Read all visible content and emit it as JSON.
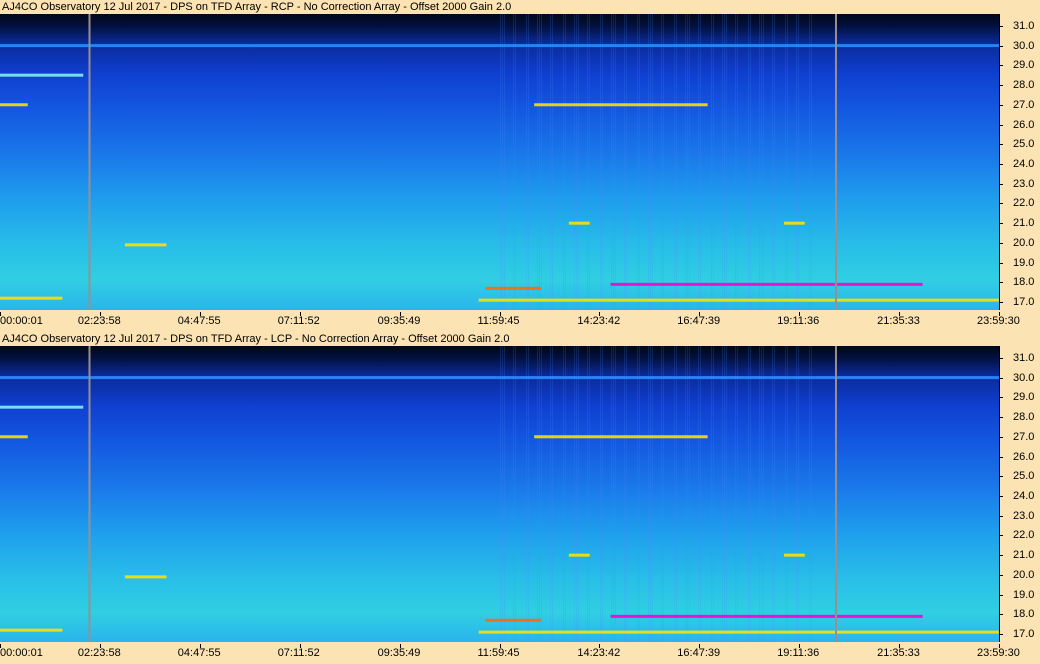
{
  "colors": {
    "background": "#fbe3b4",
    "marker": "#9a8f8f",
    "hot": "#ff00c8",
    "warm": "#ffe000"
  },
  "panels": [
    {
      "title": "AJ4CO Observatory 12 Jul 2017 - DPS on TFD Array  - RCP  -  No Correction Array  -  Offset 2000  Gain 2.0"
    },
    {
      "title": "AJ4CO Observatory 12 Jul 2017 - DPS on TFD Array  - LCP  -  No Correction Array  -  Offset 2000  Gain 2.0"
    }
  ],
  "y_ticks": [
    "31.0",
    "30.0",
    "29.0",
    "28.0",
    "27.0",
    "26.0",
    "25.0",
    "24.0",
    "23.0",
    "22.0",
    "21.0",
    "20.0",
    "19.0",
    "18.0",
    "17.0"
  ],
  "x_ticks": [
    "00:00:01",
    "02:23:58",
    "04:47:55",
    "07:11:52",
    "09:35:49",
    "11:59:45",
    "14:23:42",
    "16:47:39",
    "19:11:36",
    "21:35:33",
    "23:59:30"
  ],
  "chart_data": {
    "type": "heatmap",
    "ylim": [
      16.6,
      31.6
    ],
    "y_ticks": [
      31.0,
      30.0,
      29.0,
      28.0,
      27.0,
      26.0,
      25.0,
      24.0,
      23.0,
      22.0,
      21.0,
      20.0,
      19.0,
      18.0,
      17.0
    ],
    "x_ticks": [
      "00:00:01",
      "02:23:58",
      "04:47:55",
      "07:11:52",
      "09:35:49",
      "11:59:45",
      "14:23:42",
      "16:47:39",
      "19:11:36",
      "21:35:33",
      "23:59:30"
    ],
    "marker_times": [
      "02:09",
      "20:05"
    ],
    "bands": [
      {
        "freq": 30.0,
        "start": "00:00",
        "end": "24:00",
        "color": "#2a8cff"
      },
      {
        "freq": 27.0,
        "start": "12:50",
        "end": "17:00",
        "color": "#ffe000"
      },
      {
        "freq": 27.0,
        "start": "00:00",
        "end": "00:40",
        "color": "#ffe000"
      },
      {
        "freq": 28.5,
        "start": "00:00",
        "end": "02:00",
        "color": "#7ff0ff"
      },
      {
        "freq": 17.9,
        "start": "14:40",
        "end": "22:10",
        "color": "#ff00c8"
      },
      {
        "freq": 17.7,
        "start": "11:40",
        "end": "13:00",
        "color": "#ff6a00"
      },
      {
        "freq": 17.1,
        "start": "11:30",
        "end": "24:00",
        "color": "#ffe000"
      },
      {
        "freq": 17.2,
        "start": "00:00",
        "end": "01:30",
        "color": "#ffe000"
      },
      {
        "freq": 21.0,
        "start": "13:40",
        "end": "14:10",
        "color": "#ffe000"
      },
      {
        "freq": 21.0,
        "start": "18:50",
        "end": "19:20",
        "color": "#ffe000"
      },
      {
        "freq": 19.9,
        "start": "03:00",
        "end": "04:00",
        "color": "#ffe000"
      }
    ]
  }
}
